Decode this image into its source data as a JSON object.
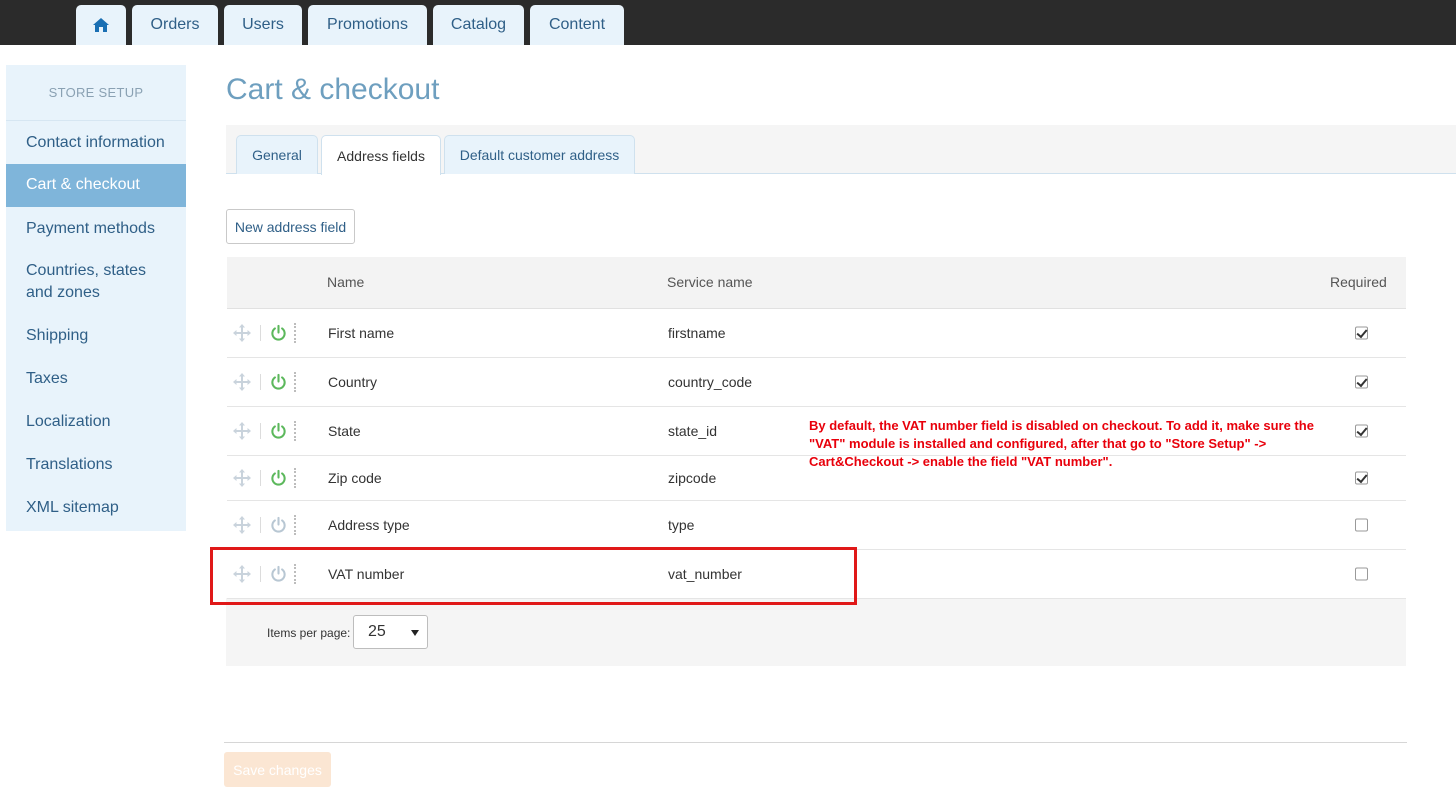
{
  "topnav": {
    "home_icon": "home-icon",
    "items": [
      "Orders",
      "Users",
      "Promotions",
      "Catalog",
      "Content"
    ]
  },
  "sidebar": {
    "header": "STORE SETUP",
    "items": [
      {
        "label": "Contact information",
        "active": false
      },
      {
        "label": "Cart & checkout",
        "active": true
      },
      {
        "label": "Payment methods",
        "active": false
      },
      {
        "label": "Countries, states and zones",
        "active": false
      },
      {
        "label": "Shipping",
        "active": false
      },
      {
        "label": "Taxes",
        "active": false
      },
      {
        "label": "Localization",
        "active": false
      },
      {
        "label": "Translations",
        "active": false
      },
      {
        "label": "XML sitemap",
        "active": false
      }
    ]
  },
  "page": {
    "title": "Cart & checkout"
  },
  "tabs": [
    {
      "label": "General",
      "active": false
    },
    {
      "label": "Address fields",
      "active": true
    },
    {
      "label": "Default customer address",
      "active": false
    }
  ],
  "toolbar": {
    "new_field_label": "New address field"
  },
  "table": {
    "headers": {
      "name": "Name",
      "service": "Service name",
      "required": "Required"
    },
    "rows": [
      {
        "name": "First name",
        "service": "firstname",
        "enabled": true,
        "required": true
      },
      {
        "name": "Country",
        "service": "country_code",
        "enabled": true,
        "required": true
      },
      {
        "name": "State",
        "service": "state_id",
        "enabled": true,
        "required": true
      },
      {
        "name": "Zip code",
        "service": "zipcode",
        "enabled": true,
        "required": true
      },
      {
        "name": "Address type",
        "service": "type",
        "enabled": false,
        "required": false
      },
      {
        "name": "VAT number",
        "service": "vat_number",
        "enabled": false,
        "required": false
      }
    ]
  },
  "pager": {
    "label": "Items per page:",
    "value": "25"
  },
  "annotation": {
    "text": "By default, the VAT number  field is disabled on checkout. To add it, make sure the \"VAT\" module is installed and configured, after that go to \"Store Setup\" -> Cart&Checkout -> enable the field \"VAT number\"."
  },
  "footer": {
    "save_label": "Save changes"
  },
  "colors": {
    "topbar": "#2b2b2b",
    "accent": "#7fb5da",
    "enabled_power": "#5cb85c",
    "disabled_power": "#b8c7d3",
    "annotation_red": "#e8000b"
  }
}
